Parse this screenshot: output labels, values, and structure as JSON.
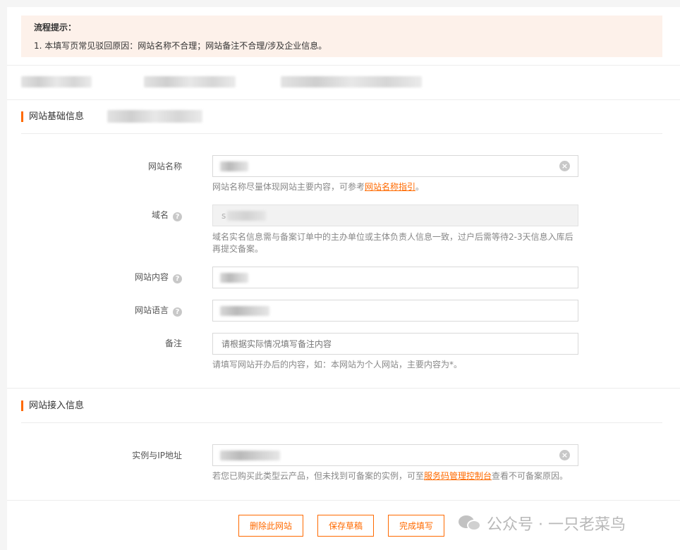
{
  "notice": {
    "title": "流程提示：",
    "text": "1. 本填写页常见驳回原因：网站名称不合理；网站备注不合理/涉及企业信息。"
  },
  "sections": {
    "basic_title": "网站基础信息",
    "access_title": "网站接入信息"
  },
  "fields": {
    "site_name": {
      "label": "网站名称",
      "hint_prefix": "网站名称尽量体现网站主要内容，可参考",
      "hint_link": "网站名称指引",
      "hint_suffix": "。"
    },
    "domain": {
      "label": "域名",
      "value_prefix": "s",
      "hint": "域名实名信息需与备案订单中的主办单位或主体负责人信息一致，过户后需等待2-3天信息入库后再提交备案。"
    },
    "content": {
      "label": "网站内容"
    },
    "language": {
      "label": "网站语言"
    },
    "remark": {
      "label": "备注",
      "placeholder": "请根据实际情况填写备注内容",
      "hint": "请填写网站开办后的内容，如：本网站为个人网站，主要内容为*。"
    },
    "instance_ip": {
      "label": "实例与IP地址",
      "hint_prefix": "若您已购买此类型云产品，但未找到可备案的实例，可至",
      "hint_link": "服务码管理控制台",
      "hint_suffix": "查看不可备案原因。"
    }
  },
  "buttons": {
    "delete": "删除此网站",
    "save_draft": "保存草稿",
    "complete": "完成填写"
  },
  "watermark": {
    "text": "公众号 · 一只老菜鸟"
  },
  "colors": {
    "accent": "#ff6a00",
    "notice_bg": "#fdf1ea"
  }
}
